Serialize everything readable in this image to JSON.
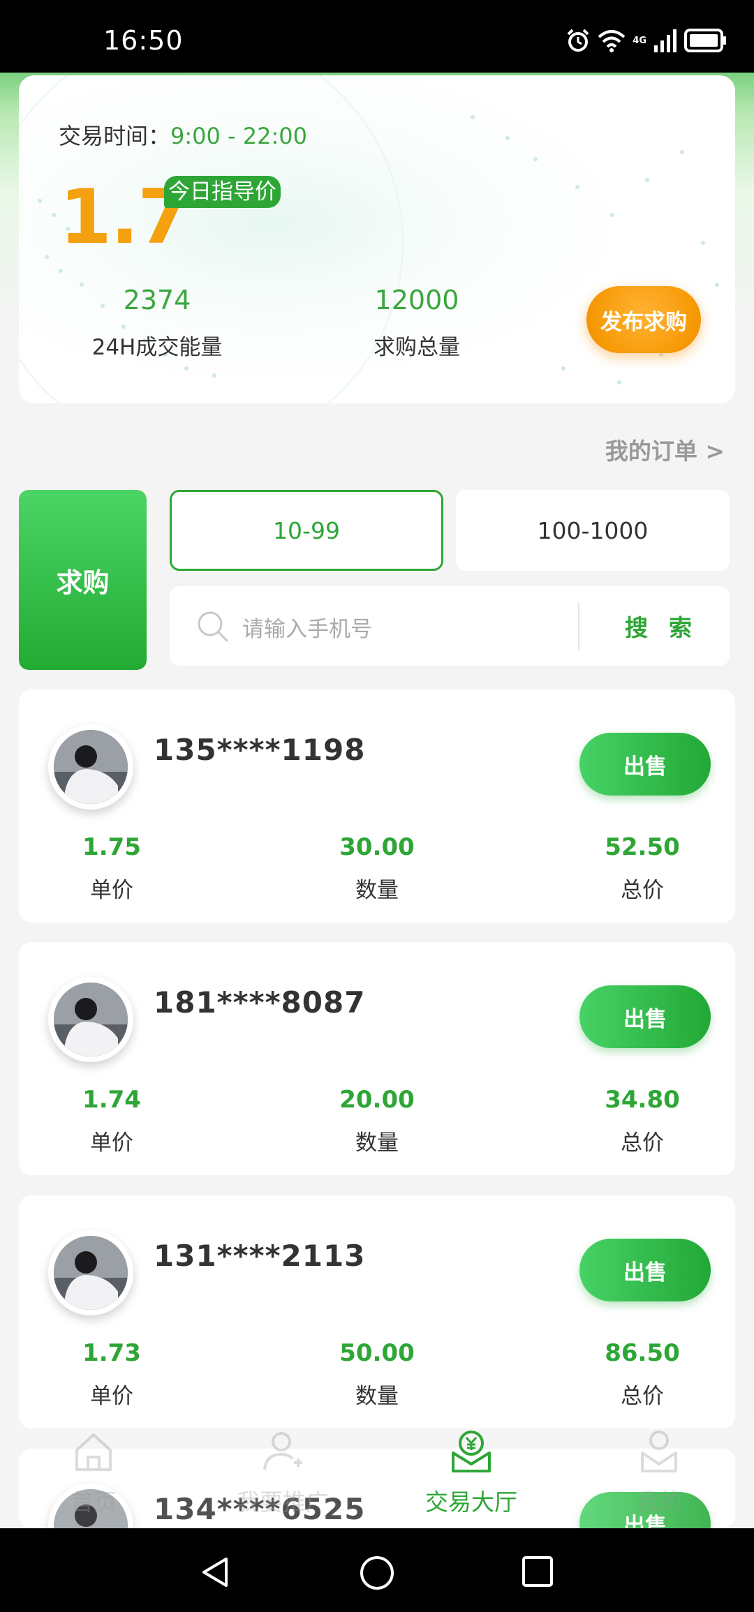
{
  "status_bar": {
    "time": "16:50",
    "network": "4G",
    "icons": [
      "alarm-icon",
      "wifi-icon",
      "signal-icon",
      "battery-icon"
    ]
  },
  "guide": {
    "trade_time_label": "交易时间：",
    "trade_time_value": "9:00 - 22:00",
    "price": "1.7",
    "badge": "今日指导价",
    "stats": [
      {
        "value": "2374",
        "label": "24H成交能量"
      },
      {
        "value": "12000",
        "label": "求购总量"
      }
    ],
    "publish_button": "发布求购"
  },
  "my_orders": "我的订单 >",
  "filter": {
    "buy_tile": "求购",
    "ranges": [
      "10-99",
      "100-1000"
    ],
    "selected_range": "10-99",
    "search_placeholder": "请输入手机号",
    "search_button": "搜索"
  },
  "orders": [
    {
      "phone": "135****1198",
      "unit_price": "1.75",
      "quantity": "30.00",
      "total": "52.50"
    },
    {
      "phone": "181****8087",
      "unit_price": "1.74",
      "quantity": "20.00",
      "total": "34.80"
    },
    {
      "phone": "131****2113",
      "unit_price": "1.73",
      "quantity": "50.00",
      "total": "86.50"
    },
    {
      "phone": "134****6525"
    }
  ],
  "order_labels": {
    "unit_price": "单价",
    "quantity": "数量",
    "total": "总价",
    "sell": "出售"
  },
  "tabs": [
    {
      "label": "首页",
      "icon": "home-icon",
      "active": false
    },
    {
      "label": "我要推广",
      "icon": "user-add-icon",
      "active": false
    },
    {
      "label": "交易大厅",
      "icon": "yuan-hall-icon",
      "active": true
    },
    {
      "label": "我的",
      "icon": "profile-icon",
      "active": false
    }
  ],
  "colors": {
    "brand_green": "#2ea636",
    "accent_orange": "#f5a00f",
    "status_bar": "#000000"
  }
}
